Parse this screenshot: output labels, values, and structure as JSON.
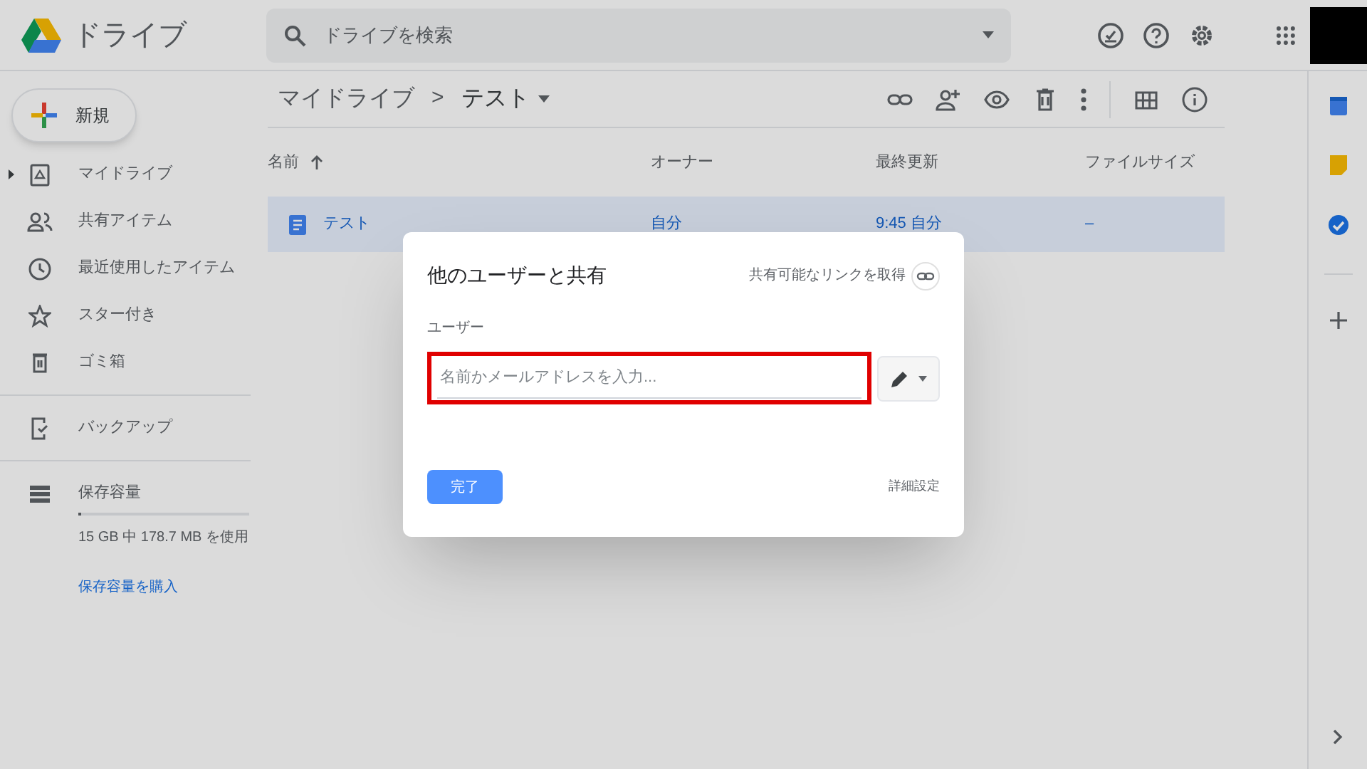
{
  "app": {
    "title": "ドライブ"
  },
  "search": {
    "placeholder": "ドライブを検索"
  },
  "new_button": {
    "label": "新規"
  },
  "sidebar": {
    "items": [
      {
        "label": "マイドライブ",
        "expandable": true
      },
      {
        "label": "共有アイテム",
        "expandable": false
      },
      {
        "label": "最近使用したアイテム",
        "expandable": false
      },
      {
        "label": "スター付き",
        "expandable": false
      },
      {
        "label": "ゴミ箱",
        "expandable": false
      },
      {
        "label": "バックアップ",
        "expandable": false
      },
      {
        "label": "保存容量",
        "expandable": false
      }
    ],
    "storage": {
      "level": 0.01,
      "usage": "15 GB 中 178.7 MB を使用",
      "buy_link": "保存容量を購入"
    }
  },
  "breadcrumb": {
    "parent": "マイドライブ",
    "separator": ">",
    "current": "テスト"
  },
  "table": {
    "columns": [
      "名前",
      "オーナー",
      "最終更新",
      "ファイルサイズ"
    ],
    "rows": [
      {
        "name": "テスト",
        "owner": "自分",
        "modified": "9:45 自分",
        "size": "–",
        "selected": true
      }
    ]
  },
  "dialog": {
    "title": "他のユーザーと共有",
    "link_action": "共有可能なリンクを取得",
    "field_label": "ユーザー",
    "field": {
      "placeholder": "名前かメールアドレスを入力...",
      "highlighted": true
    },
    "done_button": "完了",
    "advanced_link": "詳細設定"
  }
}
